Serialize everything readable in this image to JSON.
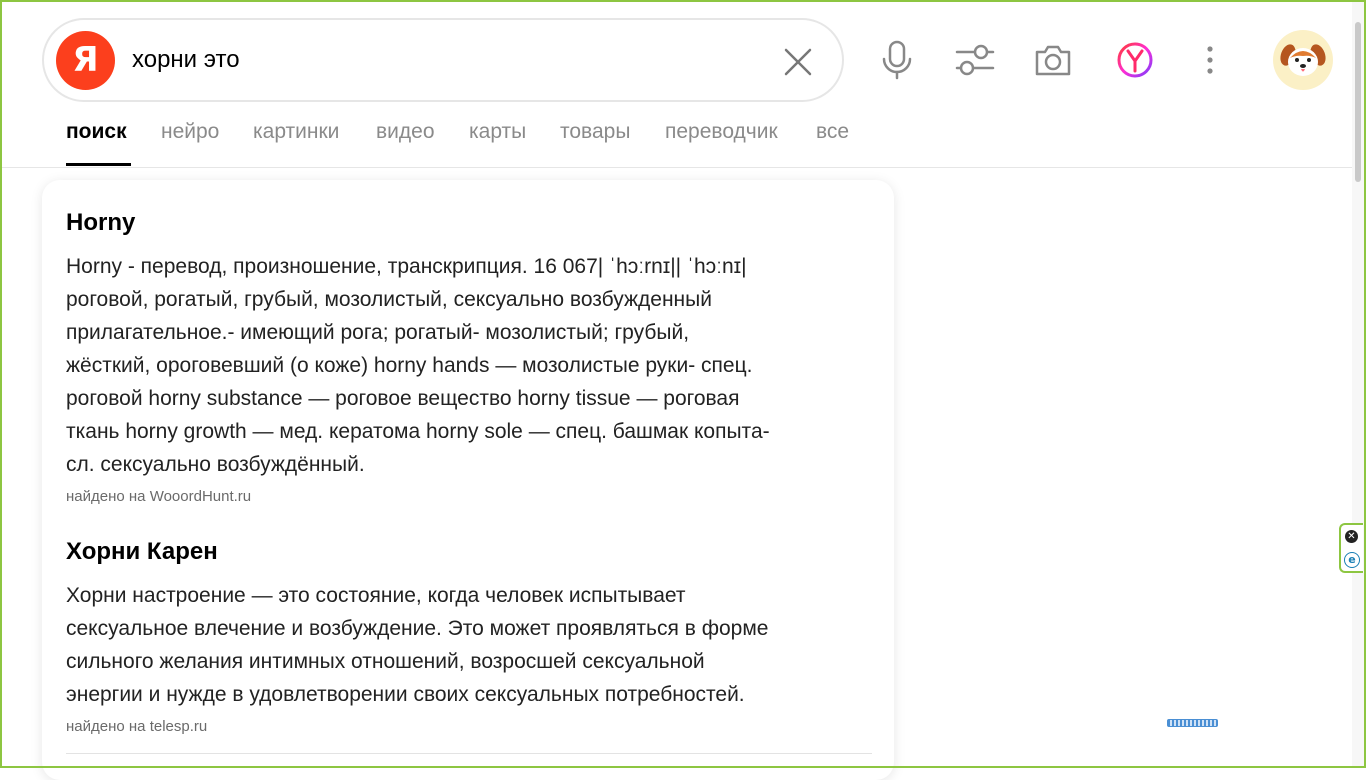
{
  "search": {
    "logo_letter": "Я",
    "query": "хорни это"
  },
  "toolbar": {
    "icons": [
      "microphone-icon",
      "filters-icon",
      "camera-icon",
      "yandex-browser-icon",
      "more-vert-icon"
    ],
    "avatar": "dog-avatar"
  },
  "tabs": [
    {
      "label": "поиск",
      "active": true
    },
    {
      "label": "нейро"
    },
    {
      "label": "картинки"
    },
    {
      "label": "видео"
    },
    {
      "label": "карты"
    },
    {
      "label": "товары"
    },
    {
      "label": "переводчик"
    },
    {
      "label": "все"
    }
  ],
  "results": [
    {
      "title": "Horny",
      "lines": [
        "Horny - перевод, произношение, транскрипция. 16 067| ˈhɔːrnɪ|| ˈhɔːnɪ|",
        "роговой, рогатый, грубый, мозолистый, сексуально возбужденный",
        "прилагательное.- имеющий рога; рогатый- мозолистый; грубый,",
        "жёсткий, ороговевший (о коже) horny hands — мозолистые руки- спец.",
        "роговой horny substance — роговое вещество horny tissue — роговая",
        "ткань horny growth — мед. кератома horny sole — спец. башмак копыта-",
        "сл. сексуально возбуждённый."
      ],
      "source_prefix": "найдено на ",
      "source_site": "WooordHunt.ru"
    },
    {
      "title": "Хорни Карен",
      "lines": [
        "Хорни настроение — это состояние, когда человек испытывает",
        "сексуальное влечение и возбуждение. Это может проявляться в форме",
        "сильного желания интимных отношений, возросшей сексуальной",
        "энергии и нужде в удовлетворении своих сексуальных потребностей."
      ],
      "source_prefix": "найдено на ",
      "source_site": "telesp.ru"
    }
  ],
  "colors": {
    "brand": "#fc3f1d",
    "frame": "#8dc641"
  }
}
